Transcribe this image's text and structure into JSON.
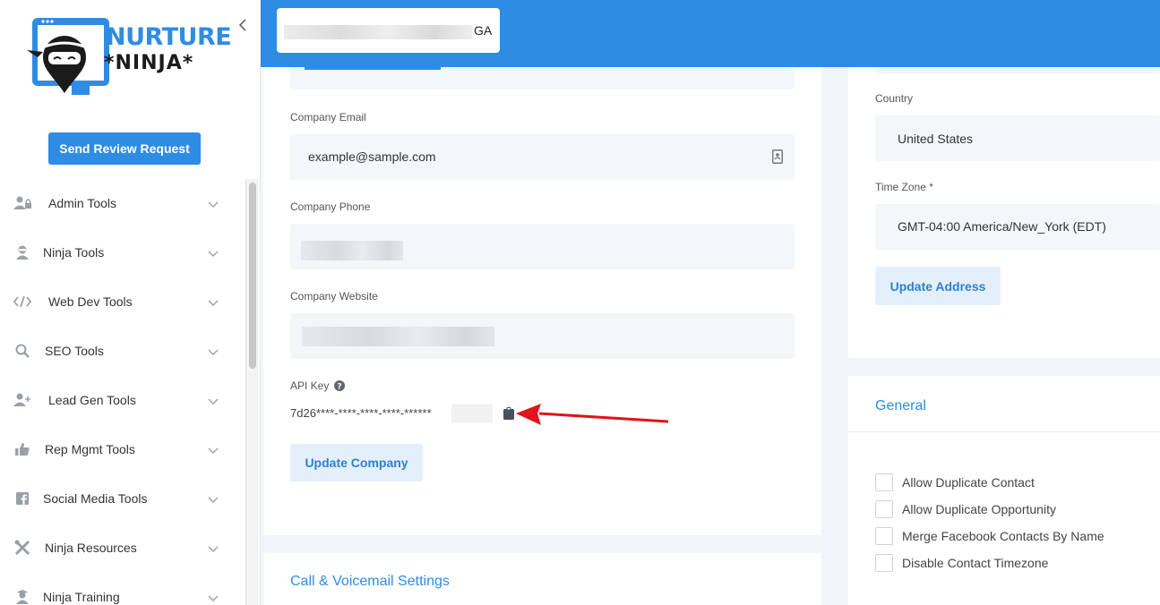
{
  "logo": {
    "line1": "NURTURE",
    "line2": "*NINJA*"
  },
  "sidebar": {
    "review_button": "Send Review Request",
    "items": [
      {
        "label": "Admin Tools",
        "icon": "user-lock-icon"
      },
      {
        "label": "Ninja Tools",
        "icon": "ninja-icon"
      },
      {
        "label": "Web Dev Tools",
        "icon": "code-icon"
      },
      {
        "label": "SEO Tools",
        "icon": "search-icon"
      },
      {
        "label": "Lead Gen Tools",
        "icon": "user-plus-icon"
      },
      {
        "label": "Rep Mgmt Tools",
        "icon": "thumbs-up-icon"
      },
      {
        "label": "Social Media Tools",
        "icon": "facebook-icon"
      },
      {
        "label": "Ninja Resources",
        "icon": "tools-icon"
      },
      {
        "label": "Ninja Training",
        "icon": "user-graduate-icon"
      }
    ]
  },
  "header": {
    "account_suffix": "GA"
  },
  "company": {
    "email_label": "Company Email",
    "email_value": "example@sample.com",
    "phone_label": "Company Phone",
    "website_label": "Company Website",
    "api_key_label": "API Key",
    "api_key_value": "7d26****-****-****-****-******",
    "update_button": "Update Company"
  },
  "call_section": {
    "title": "Call & Voicemail Settings"
  },
  "address": {
    "country_label": "Country",
    "country_value": "United States",
    "timezone_label": "Time Zone *",
    "timezone_value": "GMT-04:00 America/New_York (EDT)",
    "update_button": "Update Address"
  },
  "general": {
    "title": "General",
    "options": [
      "Allow Duplicate Contact",
      "Allow Duplicate Opportunity",
      "Merge Facebook Contacts By Name",
      "Disable Contact Timezone"
    ]
  },
  "colors": {
    "accent": "#2f8ce3",
    "annotation_arrow": "#e0141a"
  }
}
